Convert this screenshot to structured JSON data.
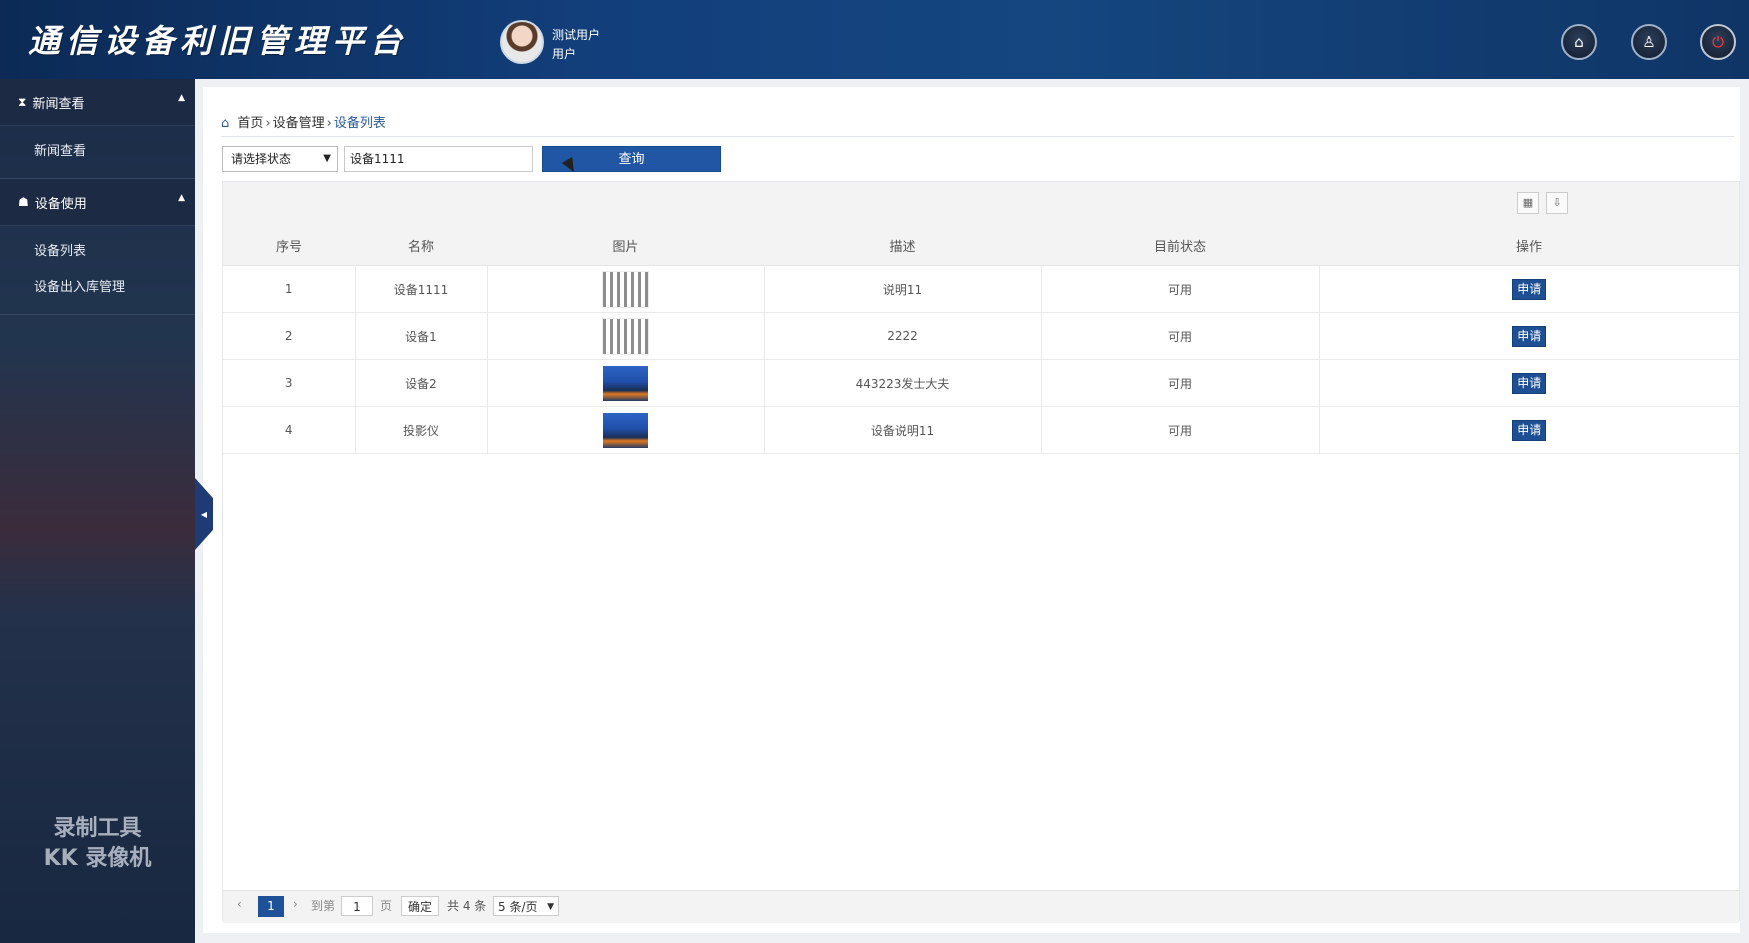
{
  "header": {
    "title": "通信设备利旧管理平台",
    "user_name": "测试用户",
    "user_role": "用户",
    "icons": [
      "home-icon",
      "user-icon",
      "power-icon"
    ]
  },
  "sidebar": {
    "groups": [
      {
        "label": "新闻查看",
        "icon": "hourglass-icon",
        "items": [
          "新闻查看"
        ]
      },
      {
        "label": "设备使用",
        "icon": "sitemap-icon",
        "items": [
          "设备列表",
          "设备出入库管理"
        ]
      }
    ],
    "watermark": [
      "录制工具",
      "KK 录像机"
    ]
  },
  "breadcrumb": [
    "首页",
    "设备管理",
    "设备列表"
  ],
  "filters": {
    "status_select": "请选择状态",
    "search_value": "设备1111",
    "query_label": "查询"
  },
  "table": {
    "columns": [
      "序号",
      "名称",
      "图片",
      "描述",
      "目前状态",
      "操作"
    ],
    "rows": [
      {
        "no": "1",
        "name": "设备1111",
        "image": "device-collage",
        "desc": "说明11",
        "status": "可用",
        "action": "申请"
      },
      {
        "no": "2",
        "name": "设备1",
        "image": "device-collage",
        "desc": "2222",
        "status": "可用",
        "action": "申请"
      },
      {
        "no": "3",
        "name": "设备2",
        "image": "blue-poster",
        "desc": "443223发士大夫",
        "status": "可用",
        "action": "申请"
      },
      {
        "no": "4",
        "name": "投影仪",
        "image": "blue-poster",
        "desc": "设备说明11",
        "status": "可用",
        "action": "申请"
      }
    ]
  },
  "pager": {
    "current_page": "1",
    "goto_label": "到第",
    "goto_value": "1",
    "page_unit": "页",
    "confirm": "确定",
    "total": "共 4 条",
    "per_page": "5 条/页"
  },
  "colors": {
    "primary": "#2056a3",
    "header_bg": "#123f7c",
    "sidebar_bg": "#1c2b43"
  }
}
